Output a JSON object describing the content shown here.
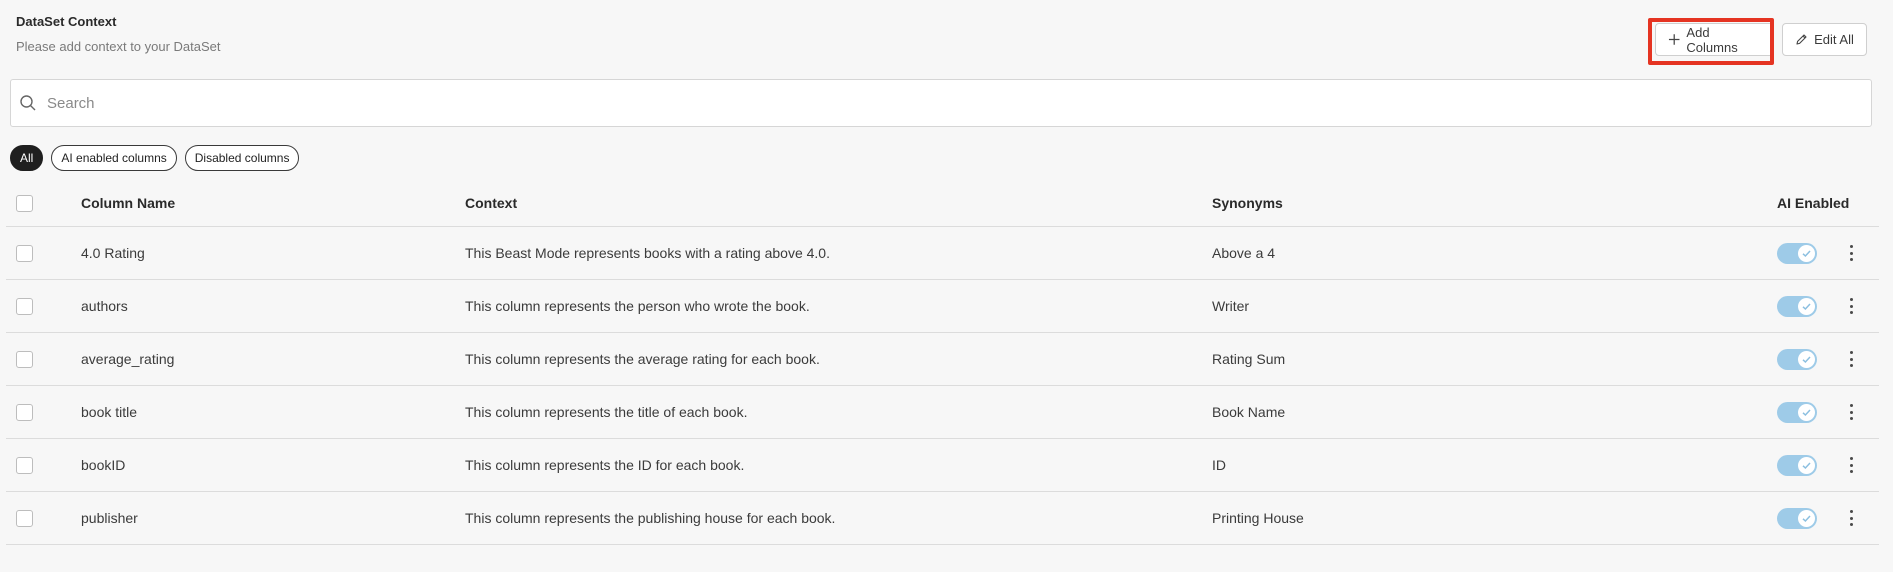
{
  "header": {
    "title": "DataSet Context",
    "subtitle": "Please add context to your DataSet"
  },
  "toolbar": {
    "add_columns_label": "Add Columns",
    "edit_all_label": "Edit All"
  },
  "search": {
    "placeholder": "Search",
    "value": ""
  },
  "filters": [
    {
      "label": "All",
      "active": true
    },
    {
      "label": "AI enabled columns",
      "active": false
    },
    {
      "label": "Disabled columns",
      "active": false
    }
  ],
  "table": {
    "headers": {
      "column_name": "Column Name",
      "context": "Context",
      "synonyms": "Synonyms",
      "ai_enabled": "AI Enabled"
    },
    "rows": [
      {
        "name": "4.0 Rating",
        "context": "This Beast Mode represents books with a rating above 4.0.",
        "synonyms": "Above a 4",
        "ai_enabled": true
      },
      {
        "name": "authors",
        "context": "This column represents the person who wrote the book.",
        "synonyms": "Writer",
        "ai_enabled": true
      },
      {
        "name": "average_rating",
        "context": "This column represents the average rating for each book.",
        "synonyms": "Rating Sum",
        "ai_enabled": true
      },
      {
        "name": "book title",
        "context": "This column represents the title of each book.",
        "synonyms": "Book Name",
        "ai_enabled": true
      },
      {
        "name": "bookID",
        "context": "This column represents the ID for each book.",
        "synonyms": "ID",
        "ai_enabled": true
      },
      {
        "name": "publisher",
        "context": "This column represents the publishing house for each book.",
        "synonyms": "Printing House",
        "ai_enabled": true
      }
    ]
  },
  "icons": {
    "add": "plus-icon",
    "edit": "pencil-icon",
    "search": "search-icon",
    "toggle_check": "check-icon",
    "row_menu": "kebab-menu-icon"
  },
  "colors": {
    "highlight": "#e53422",
    "toggle_on": "#9ecbe8",
    "active_chip": "#1f1f1f"
  }
}
